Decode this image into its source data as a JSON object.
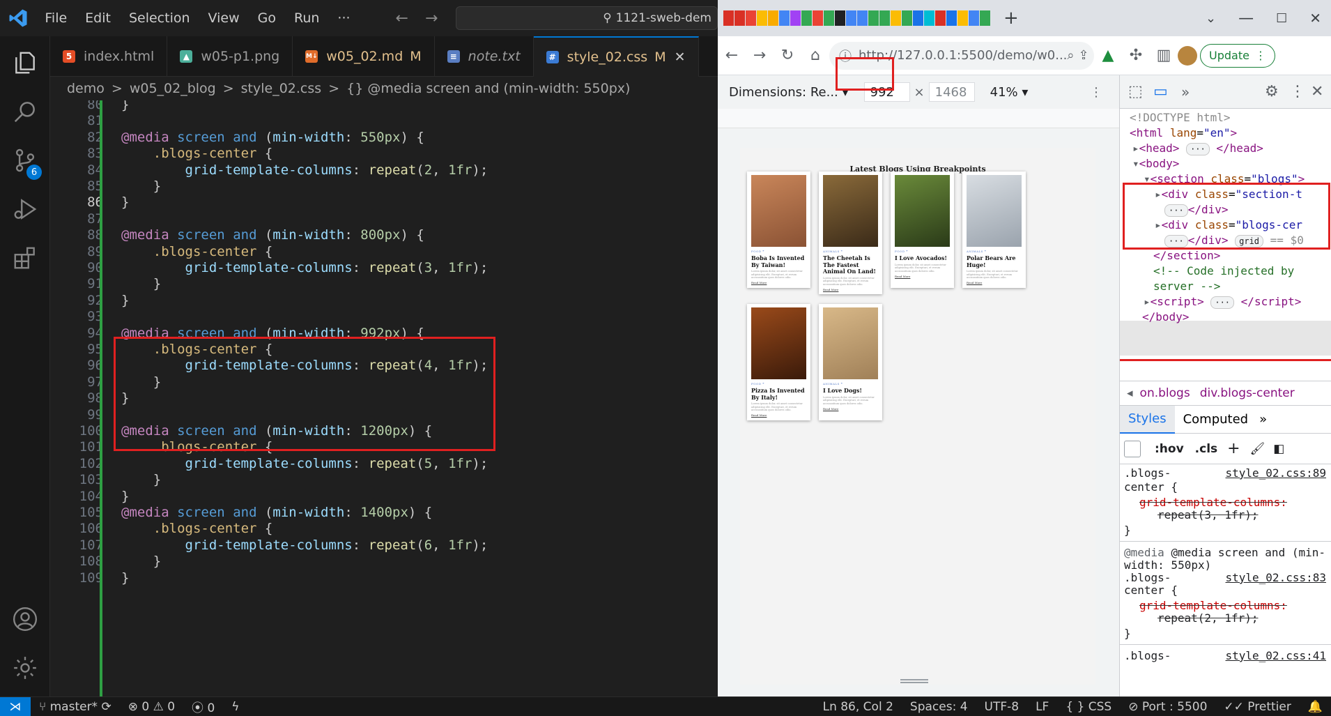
{
  "vscode": {
    "menu": [
      "File",
      "Edit",
      "Selection",
      "View",
      "Go",
      "Run",
      "···"
    ],
    "search_text": "1121-sweb-dem",
    "scm_badge": "6",
    "tabs": [
      {
        "label": "index.html",
        "mod": ""
      },
      {
        "label": "w05-p1.png",
        "mod": ""
      },
      {
        "label": "w05_02.md",
        "mod": "M"
      },
      {
        "label": "note.txt",
        "mod": ""
      },
      {
        "label": "style_02.css",
        "mod": "M"
      }
    ],
    "breadcrumb": [
      "demo",
      ">",
      "w05_02_blog",
      ">",
      "style_02.css",
      ">",
      "{} @media screen and (min-width: 550px)"
    ],
    "current_line": "86"
  },
  "code_lines": [
    {
      "n": "80",
      "t": "}"
    },
    {
      "n": "81",
      "t": ""
    },
    {
      "n": "82",
      "t": "@media screen and (min-width: 550px) {"
    },
    {
      "n": "83",
      "t": "    .blogs-center {"
    },
    {
      "n": "84",
      "t": "        grid-template-columns: repeat(2, 1fr);"
    },
    {
      "n": "85",
      "t": "    }"
    },
    {
      "n": "86",
      "t": "}"
    },
    {
      "n": "87",
      "t": ""
    },
    {
      "n": "88",
      "t": "@media screen and (min-width: 800px) {"
    },
    {
      "n": "89",
      "t": "    .blogs-center {"
    },
    {
      "n": "90",
      "t": "        grid-template-columns: repeat(3, 1fr);"
    },
    {
      "n": "91",
      "t": "    }"
    },
    {
      "n": "92",
      "t": "}"
    },
    {
      "n": "93",
      "t": ""
    },
    {
      "n": "94",
      "t": "@media screen and (min-width: 992px) {"
    },
    {
      "n": "95",
      "t": "    .blogs-center {"
    },
    {
      "n": "96",
      "t": "        grid-template-columns: repeat(4, 1fr);"
    },
    {
      "n": "97",
      "t": "    }"
    },
    {
      "n": "98",
      "t": "}"
    },
    {
      "n": "99",
      "t": ""
    },
    {
      "n": "100",
      "t": "@media screen and (min-width: 1200px) {"
    },
    {
      "n": "101",
      "t": "    .blogs-center {"
    },
    {
      "n": "102",
      "t": "        grid-template-columns: repeat(5, 1fr);"
    },
    {
      "n": "103",
      "t": "    }"
    },
    {
      "n": "104",
      "t": "}"
    },
    {
      "n": "105",
      "t": "@media screen and (min-width: 1400px) {"
    },
    {
      "n": "106",
      "t": "    .blogs-center {"
    },
    {
      "n": "107",
      "t": "        grid-template-columns: repeat(6, 1fr);"
    },
    {
      "n": "108",
      "t": "    }"
    },
    {
      "n": "109",
      "t": "}"
    }
  ],
  "status": {
    "branch": "master*",
    "problems": "⊗ 0 ⚠ 0",
    "ports": "0",
    "position": "Ln 86, Col 2",
    "spaces": "Spaces: 4",
    "encoding": "UTF-8",
    "eol": "LF",
    "language": "{ } CSS",
    "port": "Port : 5500",
    "prettier": "Prettier"
  },
  "browser": {
    "url": "http://127.0.0.1:5500/demo/w0...",
    "update_label": "Update",
    "dimensions_label": "Dimensions: Re...",
    "width": "992",
    "height": "1468",
    "zoom": "41%",
    "page_title": "Latest Blogs Using Breakpoints",
    "cards": [
      {
        "cat": "FOOD ❞",
        "title": "Boba Is Invented By Taiwan!",
        "colors": [
          "#c9865a",
          "#8a5234"
        ]
      },
      {
        "cat": "ANIMALS ❞",
        "title": "The Cheetah Is The Fastest Animal On Land!",
        "colors": [
          "#8a6a3a",
          "#3a2a18"
        ]
      },
      {
        "cat": "FOOD ❞",
        "title": "I Love Avocados!",
        "colors": [
          "#6a8a3a",
          "#2a3a18"
        ]
      },
      {
        "cat": "ANIMALS ❞",
        "title": "Polar Bears Are Huge!",
        "colors": [
          "#d8dde2",
          "#9aa3ad"
        ]
      },
      {
        "cat": "FOOD ❞",
        "title": "Pizza Is Invented By Italy!",
        "colors": [
          "#9a4a1a",
          "#3a1a0a"
        ]
      },
      {
        "cat": "ANIMALS ❞",
        "title": "I Love Dogs!",
        "colors": [
          "#d8b888",
          "#a08058"
        ]
      }
    ],
    "lorem": "Lorem ipsum dolor, sit amet consectetur adipisicing elit. Excepturi, et rerum accusantium quos dolores odio.",
    "read_more": "Read More"
  },
  "devtools": {
    "dom": [
      {
        "i": 0,
        "html": "<span class='dim'>&lt;!DOCTYPE html&gt;</span>"
      },
      {
        "i": 0,
        "html": "<span class='tg'>&lt;html</span> <span class='at'>lang</span>=<span class='av'>\"en\"</span><span class='tg'>&gt;</span>"
      }
    ],
    "breadcrumb": [
      "on.blogs",
      "div.blogs-center"
    ],
    "style_tabs": [
      "Styles",
      "Computed"
    ],
    "filter_hov": ":hov",
    "filter_cls": ".cls",
    "rules": [
      {
        "sel": ".blogs-",
        "sel2": "center {",
        "src": "style_02.css:89",
        "prop": "grid-template-columns:",
        "val": "repeat(3, 1fr);"
      },
      {
        "media": "@media screen and (min-",
        "media2": "width: 550px)",
        "sel": ".blogs-",
        "sel2": "center {",
        "src": "style_02.css:83",
        "prop": "grid-template-columns:",
        "val": "repeat(2, 1fr);"
      },
      {
        "sel": ".blogs-",
        "src": "style_02.css:41"
      }
    ]
  }
}
